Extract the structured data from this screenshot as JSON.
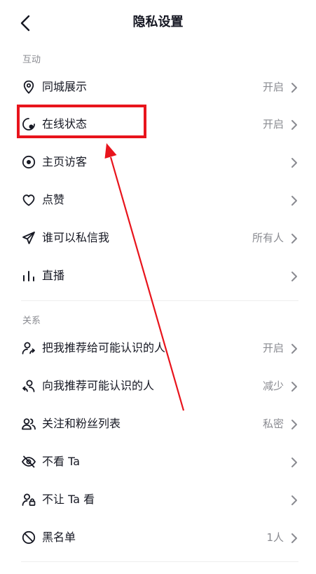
{
  "header": {
    "title": "隐私设置"
  },
  "sections": {
    "interaction": "互动",
    "relations": "关系"
  },
  "items": {
    "local_display": {
      "label": "同城展示",
      "value": "开启"
    },
    "online_status": {
      "label": "在线状态",
      "value": "开启"
    },
    "home_visitors": {
      "label": "主页访客",
      "value": ""
    },
    "likes": {
      "label": "点赞",
      "value": ""
    },
    "who_can_dm": {
      "label": "谁可以私信我",
      "value": "所有人"
    },
    "live": {
      "label": "直播",
      "value": ""
    },
    "recommend_me_to_others": {
      "label": "把我推荐给可能认识的人",
      "value": "开启"
    },
    "recommend_to_me": {
      "label": "向我推荐可能认识的人",
      "value": "减少"
    },
    "following_followers": {
      "label": "关注和粉丝列表",
      "value": "私密"
    },
    "dont_see": {
      "label": "不看 Ta",
      "value": ""
    },
    "dont_let_see": {
      "label": "不让 Ta 看",
      "value": ""
    },
    "blacklist": {
      "label": "黑名单",
      "value": "1人"
    }
  },
  "annotation": {
    "highlight_color": "#e8141c"
  }
}
